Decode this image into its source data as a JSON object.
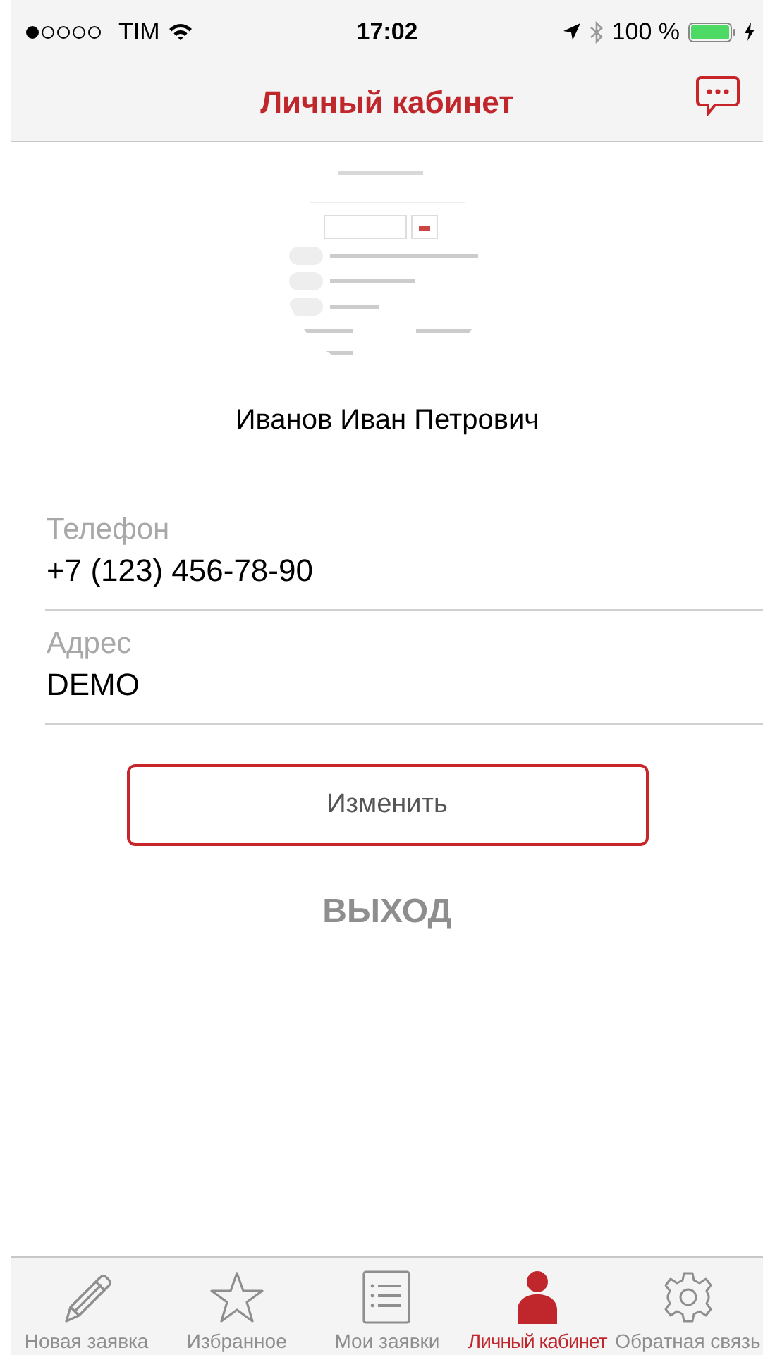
{
  "status_bar": {
    "carrier": "TIM",
    "time": "17:02",
    "battery": "100 %"
  },
  "nav": {
    "title": "Личный кабинет"
  },
  "profile": {
    "name": "Иванов Иван Петрович"
  },
  "fields": [
    {
      "label": "Телефон",
      "value": "+7 (123) 456-78-90"
    },
    {
      "label": "Адрес",
      "value": "DEMO"
    }
  ],
  "edit_button": "Изменить",
  "logout": "ВЫХОД",
  "tabs": [
    {
      "label": "Новая заявка",
      "kind": "pencil",
      "selected": false
    },
    {
      "label": "Избранное",
      "kind": "star",
      "selected": false
    },
    {
      "label": "Мои заявки",
      "kind": "list",
      "selected": false
    },
    {
      "label": "Личный кабинет",
      "kind": "person",
      "selected": true
    },
    {
      "label": "Обратная связь",
      "kind": "gear",
      "selected": false
    }
  ]
}
